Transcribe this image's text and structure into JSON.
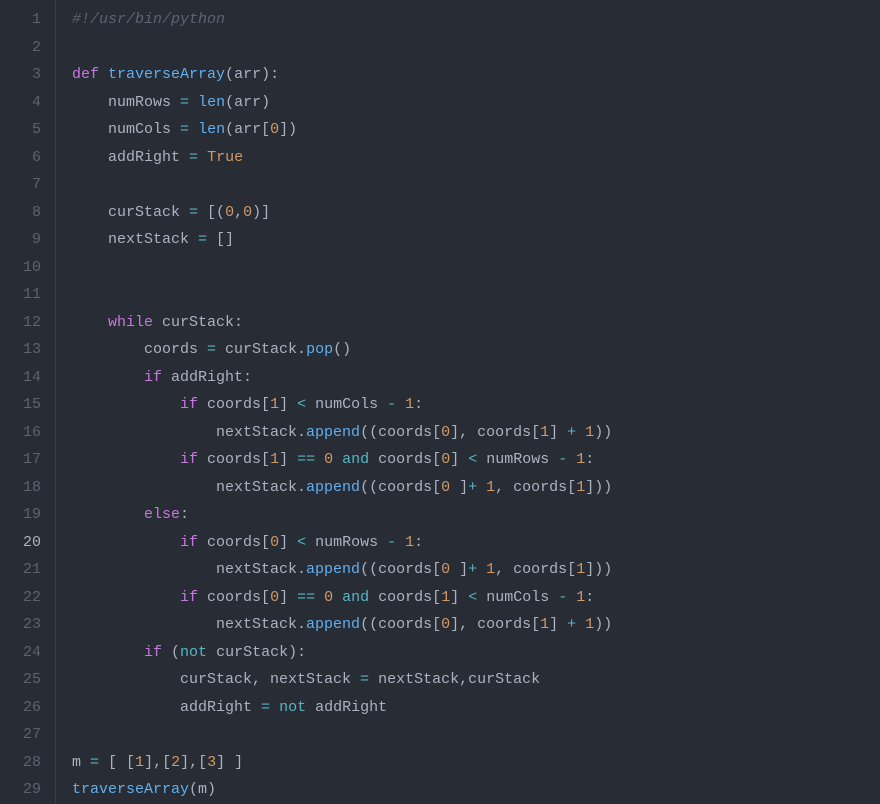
{
  "activeLine": 20,
  "lines": [
    {
      "n": 1,
      "tokens": [
        [
          "c-comment",
          "#!/usr/bin/python"
        ]
      ]
    },
    {
      "n": 2,
      "tokens": []
    },
    {
      "n": 3,
      "tokens": [
        [
          "c-def",
          "def "
        ],
        [
          "c-func",
          "traverseArray"
        ],
        [
          "c-punct",
          "("
        ],
        [
          "c-param",
          "arr"
        ],
        [
          "c-punct",
          "):"
        ]
      ]
    },
    {
      "n": 4,
      "tokens": [
        [
          "c-plain",
          "    numRows "
        ],
        [
          "c-op",
          "="
        ],
        [
          "c-plain",
          " "
        ],
        [
          "c-builtin",
          "len"
        ],
        [
          "c-punct",
          "(arr)"
        ]
      ]
    },
    {
      "n": 5,
      "tokens": [
        [
          "c-plain",
          "    numCols "
        ],
        [
          "c-op",
          "="
        ],
        [
          "c-plain",
          " "
        ],
        [
          "c-builtin",
          "len"
        ],
        [
          "c-punct",
          "(arr["
        ],
        [
          "c-num",
          "0"
        ],
        [
          "c-punct",
          "])"
        ]
      ]
    },
    {
      "n": 6,
      "tokens": [
        [
          "c-plain",
          "    addRight "
        ],
        [
          "c-op",
          "="
        ],
        [
          "c-plain",
          " "
        ],
        [
          "c-const",
          "True"
        ]
      ]
    },
    {
      "n": 7,
      "tokens": []
    },
    {
      "n": 8,
      "tokens": [
        [
          "c-plain",
          "    curStack "
        ],
        [
          "c-op",
          "="
        ],
        [
          "c-plain",
          " [("
        ],
        [
          "c-num",
          "0"
        ],
        [
          "c-punct",
          ","
        ],
        [
          "c-num",
          "0"
        ],
        [
          "c-punct",
          ")]"
        ]
      ]
    },
    {
      "n": 9,
      "tokens": [
        [
          "c-plain",
          "    nextStack "
        ],
        [
          "c-op",
          "="
        ],
        [
          "c-plain",
          " []"
        ]
      ]
    },
    {
      "n": 10,
      "tokens": []
    },
    {
      "n": 11,
      "tokens": []
    },
    {
      "n": 12,
      "tokens": [
        [
          "c-plain",
          "    "
        ],
        [
          "c-keyword",
          "while"
        ],
        [
          "c-plain",
          " curStack:"
        ]
      ]
    },
    {
      "n": 13,
      "tokens": [
        [
          "c-plain",
          "        coords "
        ],
        [
          "c-op",
          "="
        ],
        [
          "c-plain",
          " curStack."
        ],
        [
          "c-builtin",
          "pop"
        ],
        [
          "c-punct",
          "()"
        ]
      ]
    },
    {
      "n": 14,
      "tokens": [
        [
          "c-plain",
          "        "
        ],
        [
          "c-keyword",
          "if"
        ],
        [
          "c-plain",
          " addRight:"
        ]
      ]
    },
    {
      "n": 15,
      "tokens": [
        [
          "c-plain",
          "            "
        ],
        [
          "c-keyword",
          "if"
        ],
        [
          "c-plain",
          " coords["
        ],
        [
          "c-num",
          "1"
        ],
        [
          "c-punct",
          "] "
        ],
        [
          "c-op",
          "<"
        ],
        [
          "c-plain",
          " numCols "
        ],
        [
          "c-op",
          "-"
        ],
        [
          "c-plain",
          " "
        ],
        [
          "c-num",
          "1"
        ],
        [
          "c-punct",
          ":"
        ]
      ]
    },
    {
      "n": 16,
      "tokens": [
        [
          "c-plain",
          "                nextStack."
        ],
        [
          "c-builtin",
          "append"
        ],
        [
          "c-punct",
          "((coords["
        ],
        [
          "c-num",
          "0"
        ],
        [
          "c-punct",
          "], coords["
        ],
        [
          "c-num",
          "1"
        ],
        [
          "c-punct",
          "] "
        ],
        [
          "c-op",
          "+"
        ],
        [
          "c-plain",
          " "
        ],
        [
          "c-num",
          "1"
        ],
        [
          "c-punct",
          "))"
        ]
      ]
    },
    {
      "n": 17,
      "tokens": [
        [
          "c-plain",
          "            "
        ],
        [
          "c-keyword",
          "if"
        ],
        [
          "c-plain",
          " coords["
        ],
        [
          "c-num",
          "1"
        ],
        [
          "c-punct",
          "] "
        ],
        [
          "c-op",
          "=="
        ],
        [
          "c-plain",
          " "
        ],
        [
          "c-num",
          "0"
        ],
        [
          "c-plain",
          " "
        ],
        [
          "c-op",
          "and"
        ],
        [
          "c-plain",
          " coords["
        ],
        [
          "c-num",
          "0"
        ],
        [
          "c-punct",
          "] "
        ],
        [
          "c-op",
          "<"
        ],
        [
          "c-plain",
          " numRows "
        ],
        [
          "c-op",
          "-"
        ],
        [
          "c-plain",
          " "
        ],
        [
          "c-num",
          "1"
        ],
        [
          "c-punct",
          ":"
        ]
      ]
    },
    {
      "n": 18,
      "tokens": [
        [
          "c-plain",
          "                nextStack."
        ],
        [
          "c-builtin",
          "append"
        ],
        [
          "c-punct",
          "((coords["
        ],
        [
          "c-num",
          "0"
        ],
        [
          "c-plain",
          " "
        ],
        [
          "c-punct",
          "]"
        ],
        [
          "c-op",
          "+"
        ],
        [
          "c-plain",
          " "
        ],
        [
          "c-num",
          "1"
        ],
        [
          "c-punct",
          ", coords["
        ],
        [
          "c-num",
          "1"
        ],
        [
          "c-punct",
          "]))"
        ]
      ]
    },
    {
      "n": 19,
      "tokens": [
        [
          "c-plain",
          "        "
        ],
        [
          "c-keyword",
          "else"
        ],
        [
          "c-punct",
          ":"
        ]
      ]
    },
    {
      "n": 20,
      "tokens": [
        [
          "c-plain",
          "            "
        ],
        [
          "c-keyword",
          "if"
        ],
        [
          "c-plain",
          " coords["
        ],
        [
          "c-num",
          "0"
        ],
        [
          "c-punct",
          "] "
        ],
        [
          "c-op",
          "<"
        ],
        [
          "c-plain",
          " numRows "
        ],
        [
          "c-op",
          "-"
        ],
        [
          "c-plain",
          " "
        ],
        [
          "c-num",
          "1"
        ],
        [
          "c-punct",
          ":"
        ]
      ]
    },
    {
      "n": 21,
      "tokens": [
        [
          "c-plain",
          "                nextStack."
        ],
        [
          "c-builtin",
          "append"
        ],
        [
          "c-punct",
          "((coords["
        ],
        [
          "c-num",
          "0"
        ],
        [
          "c-plain",
          " "
        ],
        [
          "c-punct",
          "]"
        ],
        [
          "c-op",
          "+"
        ],
        [
          "c-plain",
          " "
        ],
        [
          "c-num",
          "1"
        ],
        [
          "c-punct",
          ", coords["
        ],
        [
          "c-num",
          "1"
        ],
        [
          "c-punct",
          "]))"
        ]
      ]
    },
    {
      "n": 22,
      "tokens": [
        [
          "c-plain",
          "            "
        ],
        [
          "c-keyword",
          "if"
        ],
        [
          "c-plain",
          " coords["
        ],
        [
          "c-num",
          "0"
        ],
        [
          "c-punct",
          "] "
        ],
        [
          "c-op",
          "=="
        ],
        [
          "c-plain",
          " "
        ],
        [
          "c-num",
          "0"
        ],
        [
          "c-plain",
          " "
        ],
        [
          "c-op",
          "and"
        ],
        [
          "c-plain",
          " coords["
        ],
        [
          "c-num",
          "1"
        ],
        [
          "c-punct",
          "] "
        ],
        [
          "c-op",
          "<"
        ],
        [
          "c-plain",
          " numCols "
        ],
        [
          "c-op",
          "-"
        ],
        [
          "c-plain",
          " "
        ],
        [
          "c-num",
          "1"
        ],
        [
          "c-punct",
          ":"
        ]
      ]
    },
    {
      "n": 23,
      "tokens": [
        [
          "c-plain",
          "                nextStack."
        ],
        [
          "c-builtin",
          "append"
        ],
        [
          "c-punct",
          "((coords["
        ],
        [
          "c-num",
          "0"
        ],
        [
          "c-punct",
          "], coords["
        ],
        [
          "c-num",
          "1"
        ],
        [
          "c-punct",
          "] "
        ],
        [
          "c-op",
          "+"
        ],
        [
          "c-plain",
          " "
        ],
        [
          "c-num",
          "1"
        ],
        [
          "c-punct",
          "))"
        ]
      ]
    },
    {
      "n": 24,
      "tokens": [
        [
          "c-plain",
          "        "
        ],
        [
          "c-keyword",
          "if"
        ],
        [
          "c-plain",
          " ("
        ],
        [
          "c-op",
          "not"
        ],
        [
          "c-plain",
          " curStack):"
        ]
      ]
    },
    {
      "n": 25,
      "tokens": [
        [
          "c-plain",
          "            curStack, nextStack "
        ],
        [
          "c-op",
          "="
        ],
        [
          "c-plain",
          " nextStack,curStack"
        ]
      ]
    },
    {
      "n": 26,
      "tokens": [
        [
          "c-plain",
          "            addRight "
        ],
        [
          "c-op",
          "="
        ],
        [
          "c-plain",
          " "
        ],
        [
          "c-op",
          "not"
        ],
        [
          "c-plain",
          " addRight"
        ]
      ]
    },
    {
      "n": 27,
      "tokens": []
    },
    {
      "n": 28,
      "tokens": [
        [
          "c-plain",
          "m "
        ],
        [
          "c-op",
          "="
        ],
        [
          "c-plain",
          " [ ["
        ],
        [
          "c-num",
          "1"
        ],
        [
          "c-punct",
          "],["
        ],
        [
          "c-num",
          "2"
        ],
        [
          "c-punct",
          "],["
        ],
        [
          "c-num",
          "3"
        ],
        [
          "c-punct",
          "] ]"
        ]
      ]
    },
    {
      "n": 29,
      "tokens": [
        [
          "c-builtin",
          "traverseArray"
        ],
        [
          "c-punct",
          "(m)"
        ]
      ]
    }
  ]
}
